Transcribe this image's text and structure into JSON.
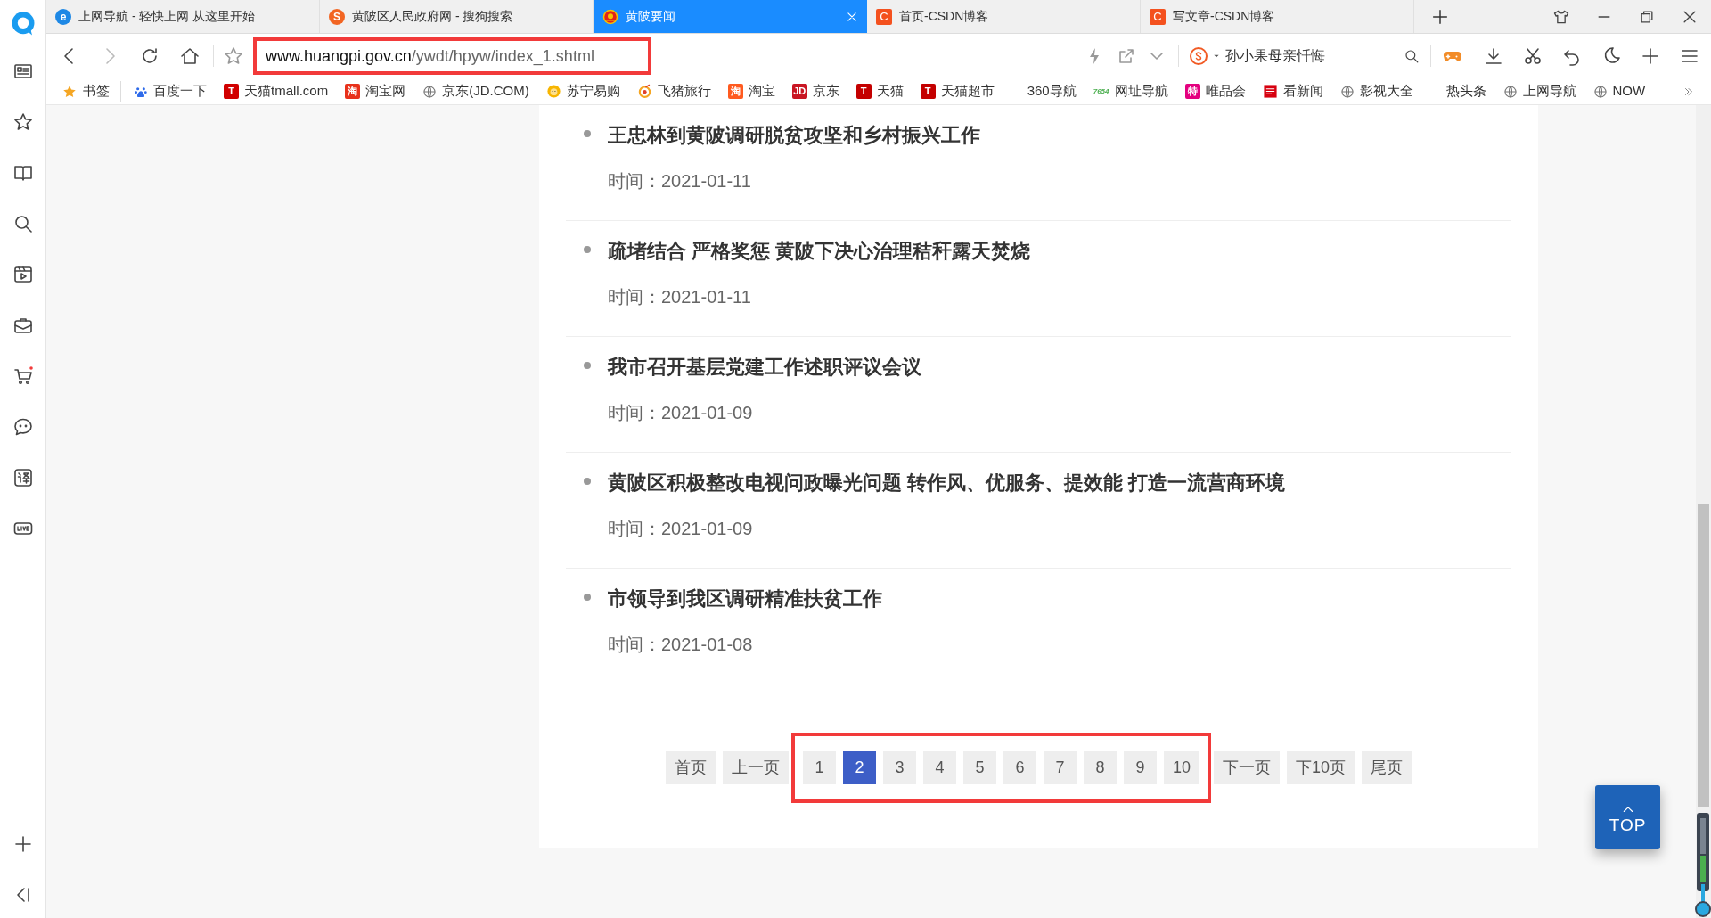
{
  "tabs": [
    {
      "title": "上网导航 - 轻快上网 从这里开始",
      "kind": "letter",
      "badge": "e",
      "color": "#1e88e5",
      "selected": false
    },
    {
      "title": "黄陂区人民政府网 - 搜狗搜索",
      "kind": "letter",
      "badge": "S",
      "color": "#f26522",
      "selected": false
    },
    {
      "title": "黄陂要闻",
      "kind": "emblem",
      "selected": true
    },
    {
      "title": "首页-CSDN博客",
      "kind": "square",
      "badge": "C",
      "color": "#f4511e",
      "selected": false
    },
    {
      "title": "写文章-CSDN博客",
      "kind": "square",
      "badge": "C",
      "color": "#f4511e",
      "selected": false
    }
  ],
  "address_bar": {
    "host": "www.huangpi.gov.cn",
    "path": "/ywdt/hpyw/index_1.shtml"
  },
  "search": {
    "value": "孙小果母亲忏悔"
  },
  "bookmarks": [
    {
      "label": "书签",
      "kind": "star"
    },
    {
      "label": "百度一下",
      "kind": "paw"
    },
    {
      "label": "天猫tmall.com",
      "kind": "badge",
      "badge": "T",
      "color": "#d10000"
    },
    {
      "label": "淘宝网",
      "kind": "badge",
      "badge": "淘",
      "color": "#e8311b"
    },
    {
      "label": "京东(JD.COM)",
      "kind": "globe"
    },
    {
      "label": "苏宁易购",
      "kind": "lion"
    },
    {
      "label": "飞猪旅行",
      "kind": "ring"
    },
    {
      "label": "淘宝",
      "kind": "badge",
      "badge": "淘",
      "color": "#ff5a1f"
    },
    {
      "label": "京东",
      "kind": "badge",
      "badge": "JD",
      "color": "#c91623"
    },
    {
      "label": "天猫",
      "kind": "badge",
      "badge": "T",
      "color": "#c40000"
    },
    {
      "label": "天猫超市",
      "kind": "badge",
      "badge": "T",
      "color": "#c40000"
    },
    {
      "label": "360导航",
      "kind": "none"
    },
    {
      "label": "网址导航",
      "kind": "tag",
      "badge": "7654",
      "color": "#4caf50"
    },
    {
      "label": "唯品会",
      "kind": "badge",
      "badge": "特",
      "color": "#e4007f"
    },
    {
      "label": "看新闻",
      "kind": "news"
    },
    {
      "label": "影视大全",
      "kind": "globe"
    },
    {
      "label": "热头条",
      "kind": "none"
    },
    {
      "label": "上网导航",
      "kind": "globe"
    },
    {
      "label": "NOW",
      "kind": "globe"
    }
  ],
  "news": [
    {
      "title": "王忠林到黄陂调研脱贫攻坚和乡村振兴工作",
      "date": "时间：2021-01-11"
    },
    {
      "title": "疏堵结合 严格奖惩 黄陂下决心治理秸秆露天焚烧",
      "date": "时间：2021-01-11"
    },
    {
      "title": "我市召开基层党建工作述职评议会议",
      "date": "时间：2021-01-09"
    },
    {
      "title": "黄陂区积极整改电视问政曝光问题 转作风、优服务、提效能 打造一流营商环境",
      "date": "时间：2021-01-09"
    },
    {
      "title": "市领导到我区调研精准扶贫工作",
      "date": "时间：2021-01-08"
    }
  ],
  "pagination": [
    {
      "label": "首页",
      "selected": false
    },
    {
      "label": "上一页",
      "selected": false
    },
    {
      "label": "1",
      "selected": false
    },
    {
      "label": "2",
      "selected": true
    },
    {
      "label": "3",
      "selected": false
    },
    {
      "label": "4",
      "selected": false
    },
    {
      "label": "5",
      "selected": false
    },
    {
      "label": "6",
      "selected": false
    },
    {
      "label": "7",
      "selected": false
    },
    {
      "label": "8",
      "selected": false
    },
    {
      "label": "9",
      "selected": false
    },
    {
      "label": "10",
      "selected": false
    },
    {
      "label": "下一页",
      "selected": false
    },
    {
      "label": "下10页",
      "selected": false
    },
    {
      "label": "尾页",
      "selected": false
    }
  ],
  "top_button": {
    "label": "TOP"
  }
}
